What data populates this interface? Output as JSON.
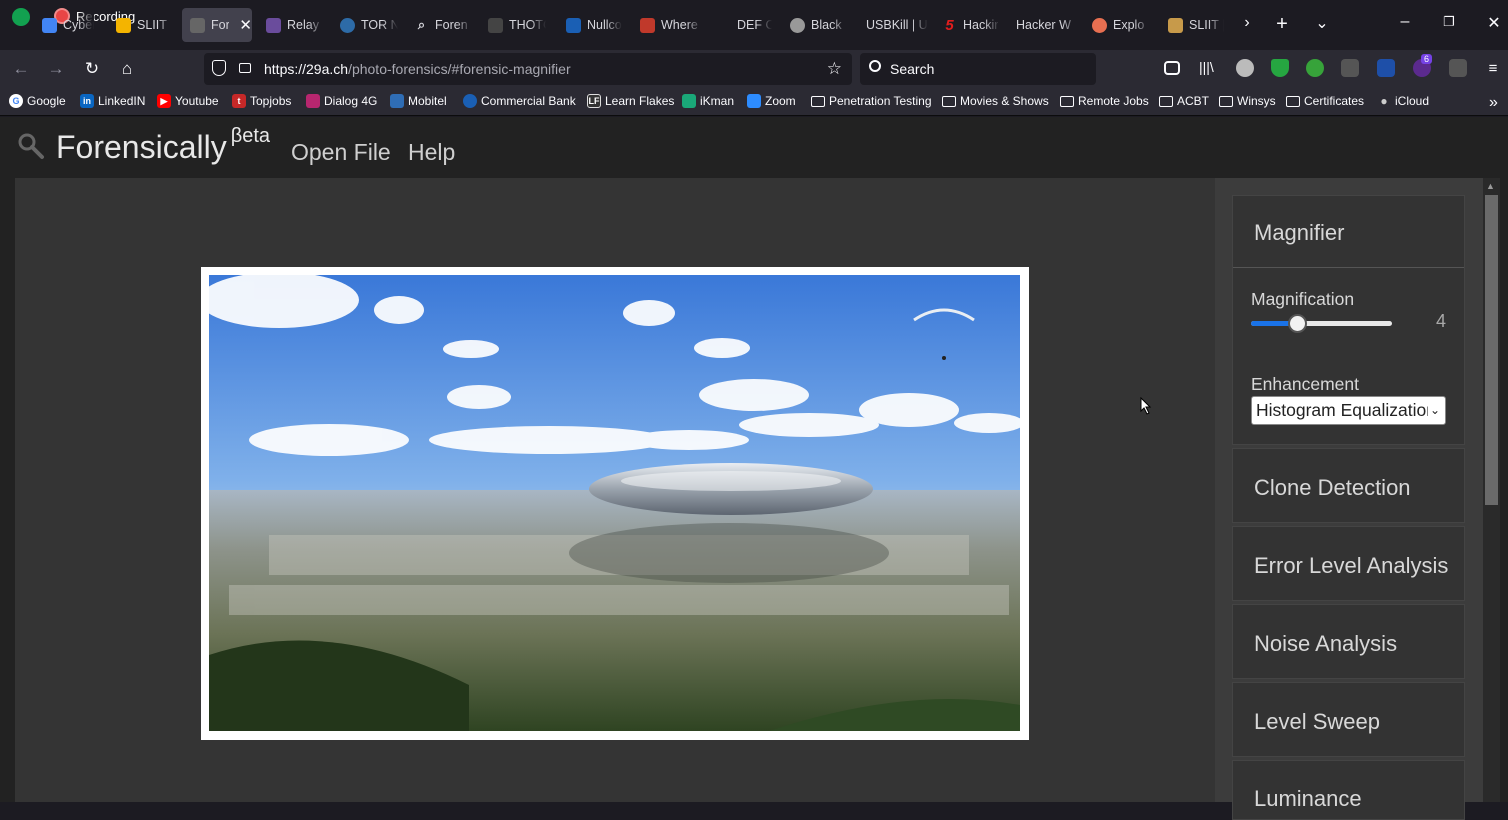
{
  "recording": "Recording",
  "tabs": [
    {
      "title": "Cyber",
      "color": "#4285f4",
      "icon": "google-drive-icon"
    },
    {
      "title": "SLIIT",
      "color": "#f4b400",
      "icon": "sliit-icon"
    },
    {
      "title": "For",
      "color": "#888888",
      "icon": "forensically-icon",
      "active": true
    },
    {
      "title": "Relay",
      "color": "#6a4c9c",
      "icon": "relay-icon"
    },
    {
      "title": "TOR N",
      "color": "#2d6ba7",
      "icon": "tor-icon"
    },
    {
      "title": "Foren",
      "color": "#777777",
      "icon": "search-icon"
    },
    {
      "title": "THOTC",
      "color": "#444444",
      "icon": "thotcon-icon"
    },
    {
      "title": "Nullco",
      "color": "#1a5fb4",
      "icon": "nullcon-icon"
    },
    {
      "title": "Where",
      "color": "#c0392b",
      "icon": "where-icon"
    },
    {
      "title": "DEF C",
      "color": "#1c1b22",
      "icon": "defcon-icon"
    },
    {
      "title": "Black",
      "color": "#999999",
      "icon": "blackhat-icon"
    },
    {
      "title": "USBKill | U",
      "color": "#1c1b22",
      "icon": "usbkill-icon"
    },
    {
      "title": "Hackir",
      "color": "#d62828",
      "icon": "hacking-icon"
    },
    {
      "title": "Hacker W",
      "color": "#1c1b22",
      "icon": "hacker-icon"
    },
    {
      "title": "Explo",
      "color": "#e76f51",
      "icon": "exploit-icon"
    },
    {
      "title": "SLIIT |",
      "color": "#c79a4a",
      "icon": "sliit-crest-icon"
    }
  ],
  "nav": {
    "url_host": "https://29a.ch",
    "url_path": "/photo-forensics/#forensic-magnifier",
    "search_placeholder": "Search"
  },
  "bookmarks": [
    {
      "label": "Google",
      "type": "site",
      "color": "#ffffff"
    },
    {
      "label": "LinkedIN",
      "type": "site",
      "color": "#0a66c2"
    },
    {
      "label": "Youtube",
      "type": "site",
      "color": "#ff0000"
    },
    {
      "label": "Topjobs",
      "type": "site",
      "color": "#c62828"
    },
    {
      "label": "Dialog 4G",
      "type": "site",
      "color": "#b7266f"
    },
    {
      "label": "Mobitel",
      "type": "site",
      "color": "#2f6db5"
    },
    {
      "label": "Commercial Bank",
      "type": "site",
      "color": "#1a5fb4"
    },
    {
      "label": "Learn Flakes",
      "type": "site",
      "color": "#333333"
    },
    {
      "label": "iKman",
      "type": "site",
      "color": "#1aa879"
    },
    {
      "label": "Zoom",
      "type": "site",
      "color": "#2d8cff"
    },
    {
      "label": "Penetration Testing",
      "type": "folder"
    },
    {
      "label": "Movies & Shows",
      "type": "folder"
    },
    {
      "label": "Remote Jobs",
      "type": "folder"
    },
    {
      "label": "ACBT",
      "type": "folder"
    },
    {
      "label": "Winsys",
      "type": "folder"
    },
    {
      "label": "Certificates",
      "type": "folder"
    },
    {
      "label": "iCloud",
      "type": "site",
      "color": "#cccccc"
    }
  ],
  "app": {
    "brand": "Forensically",
    "beta": "βeta",
    "menu_open": "Open File",
    "menu_help": "Help"
  },
  "tools": {
    "magnifier": {
      "title": "Magnifier",
      "magnification_label": "Magnification",
      "magnification_value": "4",
      "magnification_fraction": 0.33,
      "enhancement_label": "Enhancement",
      "enhancement_value": "Histogram Equalization"
    },
    "others": [
      "Clone Detection",
      "Error Level Analysis",
      "Noise Analysis",
      "Level Sweep",
      "Luminance"
    ]
  },
  "colors": {
    "accent": "#1a73e8",
    "sidebar": "#3c3c3c",
    "panel": "#333333"
  }
}
